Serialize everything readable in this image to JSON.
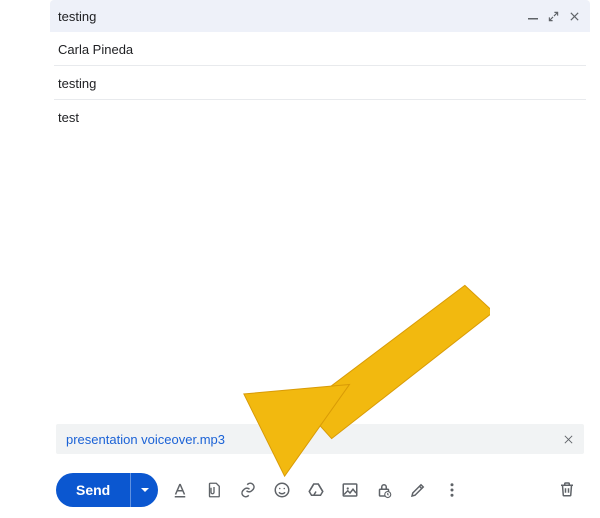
{
  "header": {
    "title": "testing"
  },
  "fields": {
    "to": "Carla Pineda",
    "subject": "testing"
  },
  "body": "test",
  "attachment": {
    "name": "presentation voiceover.mp3"
  },
  "toolbar": {
    "send_label": "Send"
  },
  "colors": {
    "accent": "#0b57d0",
    "arrow": "#f2b90f"
  }
}
